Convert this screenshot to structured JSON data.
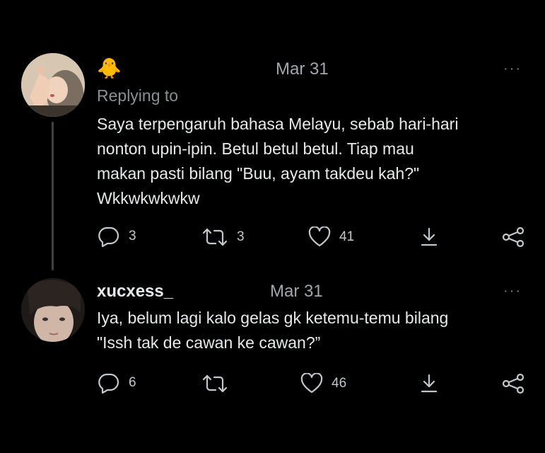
{
  "tweet1": {
    "display_name": "🐥",
    "date": "Mar 31",
    "replying_label": "Replying to",
    "text": "Saya terpengaruh bahasa Melayu, sebab hari-hari\nnonton upin-ipin. Betul betul betul. Tiap mau\nmakan pasti bilang \"Buu, ayam takdeu kah?\"\nWkkwkwkwkw",
    "more_label": "···",
    "reply_count": "3",
    "retweet_count": "3",
    "like_count": "41",
    "icons": [
      "reply-icon",
      "retweet-icon",
      "like-icon",
      "download-icon",
      "share-icon"
    ]
  },
  "tweet2": {
    "username": "xucxess_",
    "date": "Mar 31",
    "text": "Iya, belum lagi kalo gelas gk ketemu-temu bilang\n\"Issh tak de cawan ke cawan?”",
    "more_label": "···",
    "reply_count": "6",
    "retweet_count": "",
    "like_count": "46",
    "icons": [
      "reply-icon",
      "retweet-icon",
      "like-icon",
      "download-icon",
      "share-icon"
    ]
  },
  "colors": {
    "background": "#000000",
    "text": "#e7e9ea",
    "muted": "#8b8f93",
    "thread_line": "#3e4144"
  }
}
